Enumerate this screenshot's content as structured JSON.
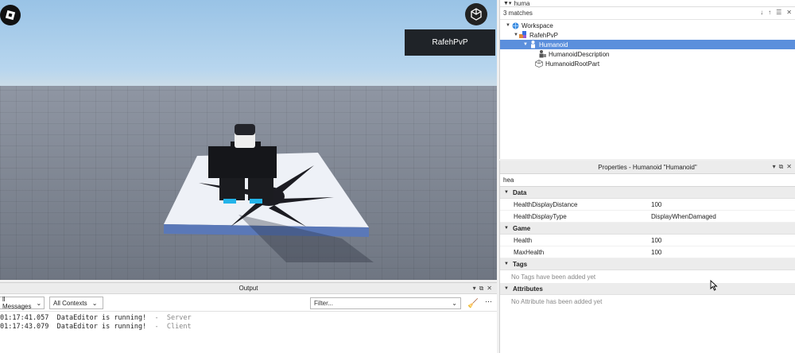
{
  "viewport": {
    "player_name": "RafehPvP",
    "logo_icon": "roblox-logo-icon",
    "cube_icon": "backpack-cube-icon"
  },
  "explorer": {
    "search_value": "huma",
    "matches": "3 matches",
    "tree": [
      {
        "label": "Workspace",
        "icon": "globe-icon"
      },
      {
        "label": "RafehPvP",
        "icon": "model-icon"
      },
      {
        "label": "Humanoid",
        "icon": "humanoid-icon"
      },
      {
        "label": "HumanoidDescription",
        "icon": "humanoid-description-icon"
      },
      {
        "label": "HumanoidRootPart",
        "icon": "part-icon"
      }
    ]
  },
  "properties": {
    "title": "Properties - Humanoid \"Humanoid\"",
    "filter_value": "hea",
    "categories": {
      "data": "Data",
      "game": "Game",
      "tags": "Tags",
      "attributes": "Attributes"
    },
    "rows": {
      "health_display_distance": {
        "name": "HealthDisplayDistance",
        "value": "100"
      },
      "health_display_type": {
        "name": "HealthDisplayType",
        "value": "DisplayWhenDamaged"
      },
      "health": {
        "name": "Health",
        "value": "100"
      },
      "max_health": {
        "name": "MaxHealth",
        "value": "100"
      }
    },
    "tags_empty": "No Tags have been added yet",
    "attributes_empty": "No Attribute has been added yet"
  },
  "output": {
    "title": "Output",
    "messages_dropdown": "ll Messages",
    "contexts_dropdown": "All Contexts",
    "filter_placeholder": "Filter...",
    "lines": [
      {
        "time": "01:17:41.057",
        "message": "DataEditor is running!",
        "sep": "-",
        "source": "Server"
      },
      {
        "time": "01:17:43.079",
        "message": "DataEditor is running!",
        "sep": "-",
        "source": "Client"
      }
    ]
  },
  "colors": {
    "selection": "#5b8fdc",
    "panel_header": "#ececec",
    "player_card": "#1f2328"
  }
}
